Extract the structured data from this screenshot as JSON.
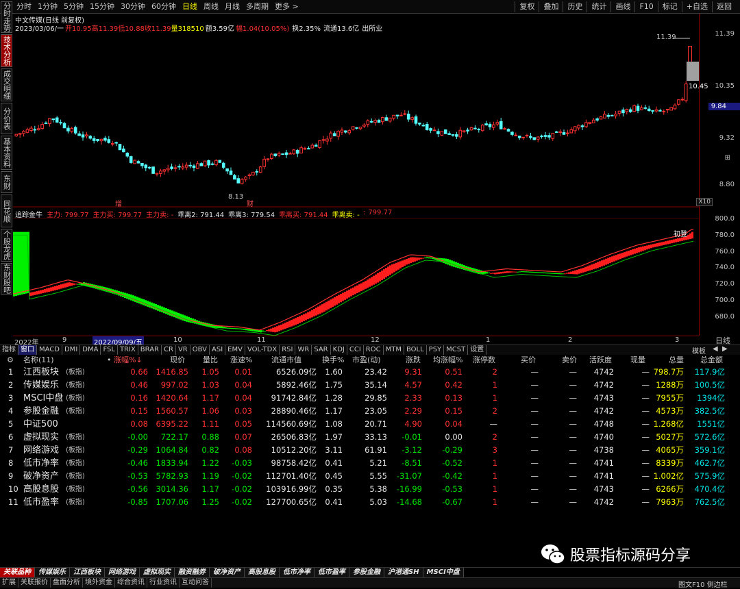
{
  "periods": [
    "分时",
    "1分钟",
    "5分钟",
    "15分钟",
    "30分钟",
    "60分钟",
    "日线",
    "周线",
    "月线",
    "多周期",
    "更多 >"
  ],
  "active_period": "日线",
  "tools": [
    "复权",
    "叠加",
    "历史",
    "统计",
    "画线",
    "F10",
    "标记",
    "+自选",
    "返回"
  ],
  "left_tabs": [
    "分时走势",
    "技术分析",
    "成交明细",
    "分价表",
    "基本资料",
    "东财",
    "同花顺",
    "个股龙虎",
    "东财股吧"
  ],
  "info": {
    "title": "中文传媒(日线 前复权)",
    "date": "2023/03/06/一",
    "open": "开10.95",
    "high": "高11.39",
    "low": "低10.88",
    "close": "收11.39",
    "volume": "量318510",
    "amount": "额3.59亿",
    "change": "幅1.04(10.05%)",
    "turnover": "换2.35%",
    "float_cap": "流通13.6亿",
    "note": "出所业"
  },
  "price_axis": [
    "11.39",
    "10.35",
    "9.84",
    "9.32",
    "8.80"
  ],
  "price_labels": {
    "high": "11.39",
    "mark": "10.45",
    "low": "8.13",
    "zoom": "X10",
    "zeng": "增",
    "cai": "财"
  },
  "indicator": {
    "name": "追踪金牛",
    "legend": [
      "主力: 799.77",
      "主力买: 799.77",
      "主力卖: -",
      "乖离2: 791.44",
      "乖离3: 779.54",
      "乖离买: 791.44",
      "乖离卖: -",
      ": 799.77"
    ],
    "axis": [
      "800.0",
      "780.0",
      "760.0",
      "740.0",
      "720.0",
      "700.0",
      "680.0"
    ],
    "badge": "初登"
  },
  "date_axis": [
    "2022年",
    "9",
    "2022/09/09/五",
    "10",
    "11",
    "12",
    "1",
    "2",
    "3"
  ],
  "date_right": "日线",
  "indicator_tabs": [
    "指标",
    "窗口",
    "MACD",
    "DMI",
    "DMA",
    "FSL",
    "TRIX",
    "BRAR",
    "CR",
    "VR",
    "OBV",
    "ASI",
    "EMV",
    "VOL-TDX",
    "RSI",
    "WR",
    "SAR",
    "KDJ",
    "CCI",
    "ROC",
    "MTM",
    "BOLL",
    "PSY",
    "MCST",
    "设置"
  ],
  "indicator_tabs_right": "模板",
  "table": {
    "headers": [
      "名称(11)",
      "•",
      "涨幅%↓",
      "现价",
      "量比",
      "涨速%",
      "流通市值",
      "换手%",
      "市盈(动)",
      "涨跌",
      "均涨幅%",
      "涨停数",
      "买价",
      "卖价",
      "活跃度",
      "现量",
      "总量",
      "总金额"
    ],
    "rows": [
      {
        "no": "1",
        "name": "江西板块",
        "tag": "(板指)",
        "chg": "0.66",
        "price": "1416.85",
        "vr": "1.05",
        "spd": "0.01",
        "mcap": "6526.09亿",
        "turn": "1.60",
        "pe": "23.42",
        "delta": "9.31",
        "avg": "0.51",
        "limit": "2",
        "bid": "—",
        "ask": "—",
        "act": "4742",
        "now": "—",
        "vol": "798.7万",
        "amt": "117.9亿"
      },
      {
        "no": "2",
        "name": "传媒娱乐",
        "tag": "(板指)",
        "chg": "0.46",
        "price": "997.02",
        "vr": "1.03",
        "spd": "0.04",
        "mcap": "5892.46亿",
        "turn": "1.75",
        "pe": "35.14",
        "delta": "4.57",
        "avg": "0.42",
        "limit": "1",
        "bid": "—",
        "ask": "—",
        "act": "4742",
        "now": "—",
        "vol": "1288万",
        "amt": "100.5亿"
      },
      {
        "no": "3",
        "name": "MSCI中盘",
        "tag": "(板指)",
        "chg": "0.16",
        "price": "1420.64",
        "vr": "1.17",
        "spd": "0.04",
        "mcap": "91742.84亿",
        "turn": "1.28",
        "pe": "29.85",
        "delta": "2.33",
        "avg": "0.13",
        "limit": "1",
        "bid": "—",
        "ask": "—",
        "act": "4743",
        "now": "—",
        "vol": "7955万",
        "amt": "1394亿"
      },
      {
        "no": "4",
        "name": "参股金融",
        "tag": "(板指)",
        "chg": "0.15",
        "price": "1560.57",
        "vr": "1.06",
        "spd": "0.03",
        "mcap": "28890.46亿",
        "turn": "1.17",
        "pe": "23.05",
        "delta": "2.29",
        "avg": "0.15",
        "limit": "2",
        "bid": "—",
        "ask": "—",
        "act": "4742",
        "now": "—",
        "vol": "4573万",
        "amt": "382.5亿"
      },
      {
        "no": "5",
        "name": "中证500",
        "tag": "",
        "chg": "0.08",
        "price": "6395.22",
        "vr": "1.11",
        "spd": "0.05",
        "mcap": "114560.69亿",
        "turn": "1.08",
        "pe": "20.71",
        "delta": "4.90",
        "avg": "0.04",
        "limit": "—",
        "bid": "—",
        "ask": "—",
        "act": "4748",
        "now": "—",
        "vol": "1.268亿",
        "amt": "1551亿"
      },
      {
        "no": "6",
        "name": "虚拟现实",
        "tag": "(板指)",
        "chg": "-0.00",
        "price": "722.17",
        "vr": "0.88",
        "spd": "0.07",
        "mcap": "26506.83亿",
        "turn": "1.97",
        "pe": "33.13",
        "delta": "-0.01",
        "avg": "0.00",
        "limit": "2",
        "bid": "—",
        "ask": "—",
        "act": "4740",
        "now": "—",
        "vol": "5027万",
        "amt": "572.6亿"
      },
      {
        "no": "7",
        "name": "网络游戏",
        "tag": "(板指)",
        "chg": "-0.29",
        "price": "1064.84",
        "vr": "0.82",
        "spd": "0.08",
        "mcap": "10512.20亿",
        "turn": "3.11",
        "pe": "61.91",
        "delta": "-3.12",
        "avg": "-0.29",
        "limit": "3",
        "bid": "—",
        "ask": "—",
        "act": "4738",
        "now": "—",
        "vol": "4065万",
        "amt": "359.1亿"
      },
      {
        "no": "8",
        "name": "低市净率",
        "tag": "(板指)",
        "chg": "-0.46",
        "price": "1833.94",
        "vr": "1.22",
        "spd": "-0.03",
        "mcap": "98758.42亿",
        "turn": "0.41",
        "pe": "5.21",
        "delta": "-8.51",
        "avg": "-0.52",
        "limit": "1",
        "bid": "—",
        "ask": "—",
        "act": "4741",
        "now": "—",
        "vol": "8339万",
        "amt": "462.7亿"
      },
      {
        "no": "9",
        "name": "破净资产",
        "tag": "(板指)",
        "chg": "-0.53",
        "price": "5782.93",
        "vr": "1.19",
        "spd": "-0.02",
        "mcap": "112701.40亿",
        "turn": "0.45",
        "pe": "5.55",
        "delta": "-31.07",
        "avg": "-0.42",
        "limit": "1",
        "bid": "—",
        "ask": "—",
        "act": "4741",
        "now": "—",
        "vol": "1.002亿",
        "amt": "575.9亿"
      },
      {
        "no": "10",
        "name": "高股息股",
        "tag": "(板指)",
        "chg": "-0.56",
        "price": "3014.36",
        "vr": "1.17",
        "spd": "-0.02",
        "mcap": "103916.99亿",
        "turn": "0.35",
        "pe": "5.38",
        "delta": "-16.99",
        "avg": "-0.53",
        "limit": "1",
        "bid": "—",
        "ask": "—",
        "act": "4743",
        "now": "—",
        "vol": "6266万",
        "amt": "470.4亿"
      },
      {
        "no": "11",
        "name": "低市盈率",
        "tag": "(板指)",
        "chg": "-0.85",
        "price": "1707.06",
        "vr": "1.25",
        "spd": "-0.02",
        "mcap": "127700.65亿",
        "turn": "0.41",
        "pe": "5.03",
        "delta": "-14.68",
        "avg": "-0.67",
        "limit": "1",
        "bid": "—",
        "ask": "—",
        "act": "4742",
        "now": "—",
        "vol": "7963万",
        "amt": "762.5亿"
      }
    ]
  },
  "sector_tabs": [
    "关联品种",
    "传媒娱乐",
    "江西板块",
    "网络游戏",
    "虚拟现实",
    "融资融券",
    "破净资产",
    "高股息股",
    "低市净率",
    "低市盈率",
    "参股金融",
    "沪港通SH",
    "MSCI中盘"
  ],
  "status_tabs": [
    "扩展",
    "关联报价",
    "盘面分析",
    "境外资金",
    "综合资讯",
    "行业资讯",
    "互动问答"
  ],
  "status_right": "图文F10 侧边栏",
  "watermark": "股票指标源码分享",
  "colors": {
    "up": "#ff3232",
    "down": "#00e600",
    "down_candle": "#54fcfc",
    "accent": "#ffff00"
  }
}
